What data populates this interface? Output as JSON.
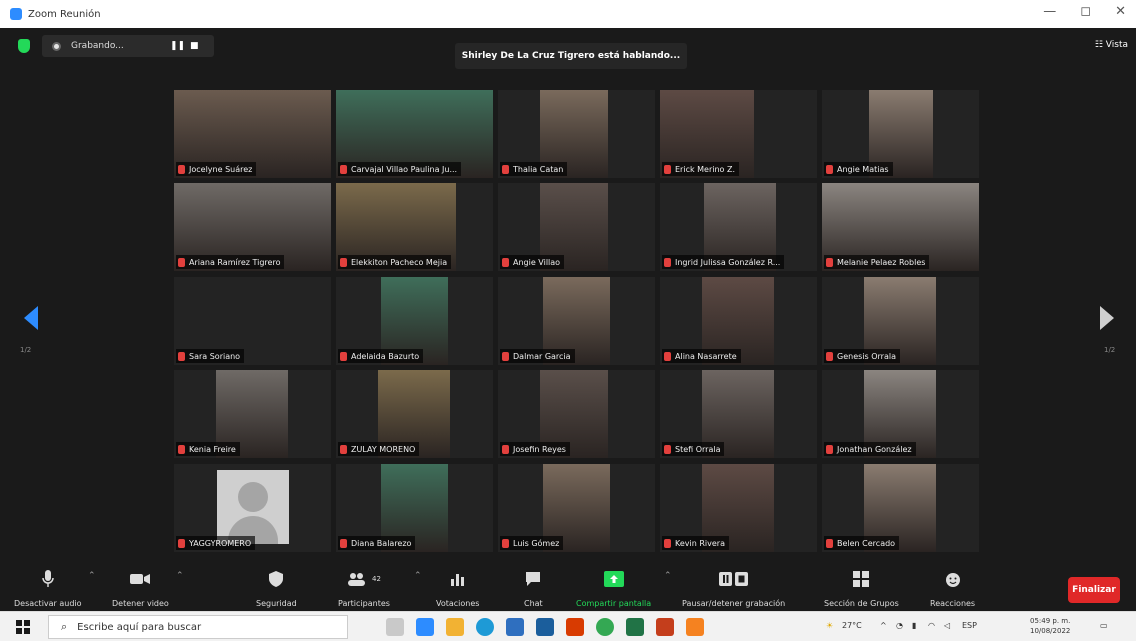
{
  "window": {
    "title": "Zoom Reunión",
    "controls": [
      "—",
      "◻",
      "✕"
    ]
  },
  "recording": {
    "label": "Grabando...",
    "pause": "❚❚",
    "stop": "■"
  },
  "speaking_banner": "Shirley De La Cruz Tigrero está hablando...",
  "view_label": "☷ Vista",
  "pagination": {
    "prev_page": "1/2",
    "next_page": "1/2"
  },
  "participants": [
    {
      "name": "Jocelyne Suárez",
      "img": "https://i.imgur.com/aFk3x8R.jpg"
    },
    {
      "name": "Carvajal Villao Paulina Ju...",
      "img": "https://i.imgur.com/3JH0gqs.jpg"
    },
    {
      "name": "Thalia Catan",
      "img": "https://i.imgur.com/k29Qb2C.jpg"
    },
    {
      "name": "Erick Merino Z.",
      "img": "https://i.imgur.com/U8hW3pB.jpg"
    },
    {
      "name": "Angie Matias",
      "img": "https://i.imgur.com/rcW6sY7.jpg"
    },
    {
      "name": "Ariana Ramírez Tigrero",
      "img": "https://i.imgur.com/6d0Mj6T.jpg"
    },
    {
      "name": "Elekkiton Pacheco Mejia",
      "img": "https://i.imgur.com/Qy1M0yL.jpg"
    },
    {
      "name": "Angie Villao",
      "img": "https://i.imgur.com/xb1pIJZ.jpg"
    },
    {
      "name": "Ingrid Julissa González R...",
      "img": "https://i.imgur.com/ChzU1w5.jpg"
    },
    {
      "name": "Melanie Pelaez Robles",
      "img": "https://i.imgur.com/nq4rOfr.jpg"
    },
    {
      "name": "Sara Soriano",
      "img": ""
    },
    {
      "name": "Adelaida Bazurto",
      "img": "https://i.imgur.com/yKfqjFr.jpg"
    },
    {
      "name": "Dalmar Garcia",
      "img": "https://i.imgur.com/zZzKyIh.jpg"
    },
    {
      "name": "Alina Nasarrete",
      "img": "https://i.imgur.com/XrN8Vnv.jpg"
    },
    {
      "name": "Genesis Orrala",
      "img": "https://i.imgur.com/K95WquD.jpg"
    },
    {
      "name": "Kenia Freire",
      "img": "https://i.imgur.com/9lq3BH5.jpg"
    },
    {
      "name": "ZULAY MORENO",
      "img": "https://i.imgur.com/AXQ8Z3G.jpg"
    },
    {
      "name": "Josefin Reyes",
      "img": "https://i.imgur.com/jPZA6Qo.jpg"
    },
    {
      "name": "Stefi Orrala",
      "img": "https://i.imgur.com/NbY5Rnm.jpg"
    },
    {
      "name": "Jonathan González",
      "img": "https://i.imgur.com/u5jUkgZ.jpg"
    },
    {
      "name": "YAGGYROMERO",
      "img": "avatar"
    },
    {
      "name": "Diana Balarezo",
      "img": "https://i.imgur.com/eXQ4w3A.jpg"
    },
    {
      "name": "Luis Gómez",
      "img": "https://i.imgur.com/bTzWnSS.jpg"
    },
    {
      "name": "Kevin Rivera",
      "img": "https://i.imgur.com/tgQ1O26.jpg"
    },
    {
      "name": "Belen Cercado",
      "img": "https://i.imgur.com/Ge6v2oM.jpg"
    }
  ],
  "toolbar": {
    "mute": "Desactivar audio",
    "video": "Detener video",
    "security": "Seguridad",
    "participants": "Participantes",
    "participants_count": "42",
    "polls": "Votaciones",
    "chat": "Chat",
    "share": "Compartir pantalla",
    "record": "Pausar/detener grabación",
    "breakout": "Sección de Grupos",
    "reactions": "Reacciones",
    "end": "Finalizar"
  },
  "taskbar": {
    "search_placeholder": "Escribe aquí para buscar",
    "weather": "27°C",
    "language": "ESP",
    "time": "05:49 p. m.",
    "date": "10/08/2022"
  },
  "colors": {
    "accent": "#2d8cff",
    "share_green": "#23d959",
    "end_red": "#e02828",
    "mic_muted": "#e2403d"
  }
}
